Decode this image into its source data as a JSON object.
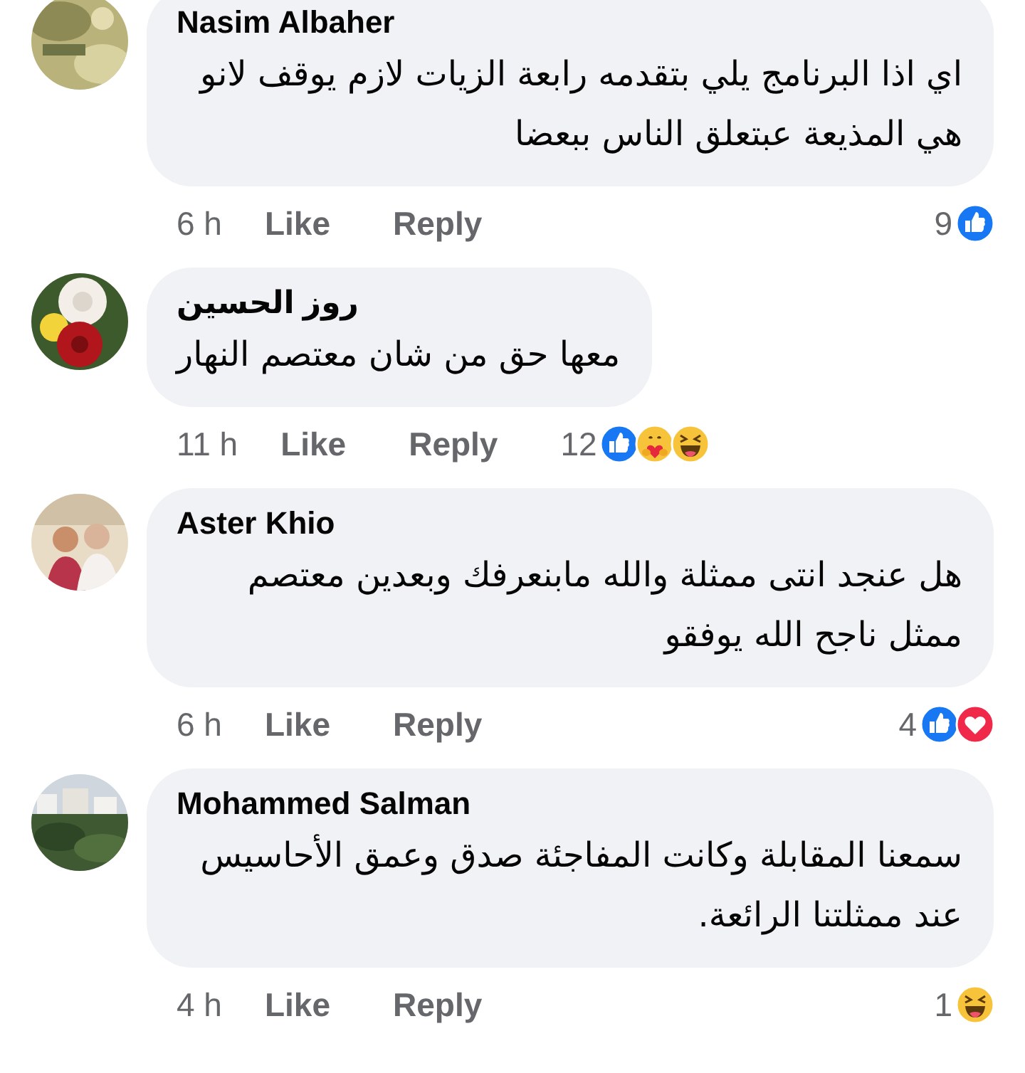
{
  "comments": [
    {
      "author": "Nasim Albaher",
      "avatar": {
        "kind": "picture"
      },
      "text": "اي اذا البرنامج يلي بتقدمه رابعة الزيات لازم يوقف لانو هي المذيعة عبتعلق الناس ببعضا",
      "time": "6 h",
      "like": "Like",
      "reply": "Reply",
      "reaction_count": "9",
      "reactions": [
        {
          "kind": "like"
        }
      ]
    },
    {
      "author": "روز الحسين",
      "avatar": {
        "kind": "picture"
      },
      "text": "معها حق من شان معتصم النهار",
      "time": "11 h",
      "like": "Like",
      "reply": "Reply",
      "reaction_count": "12",
      "reactions": [
        {
          "kind": "like"
        },
        {
          "kind": "care"
        },
        {
          "kind": "haha"
        }
      ]
    },
    {
      "author": "Aster Khio",
      "avatar": {
        "kind": "picture"
      },
      "text": "هل عنجد انتى ممثلة  والله مابنعرفك  وبعدين معتصم ممثل ناجح الله يوفقو",
      "time": "6 h",
      "like": "Like",
      "reply": "Reply",
      "reaction_count": "4",
      "reactions": [
        {
          "kind": "like"
        },
        {
          "kind": "love"
        }
      ]
    },
    {
      "author": "Mohammed Salman",
      "avatar": {
        "kind": "picture"
      },
      "text": "سمعنا المقابلة وكانت المفاجئة صدق وعمق الأحاسيس عند ممثلتنا الرائعة.",
      "time": "4 h",
      "like": "Like",
      "reply": "Reply",
      "reaction_count": "1",
      "reactions": [
        {
          "kind": "haha"
        }
      ]
    }
  ]
}
